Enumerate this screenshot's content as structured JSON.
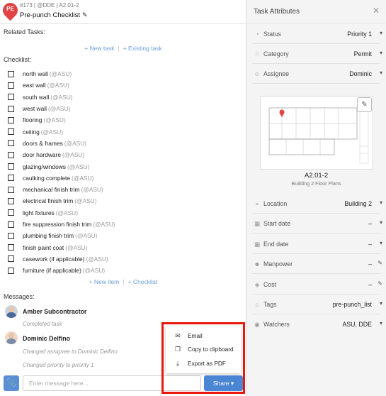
{
  "header": {
    "avatar_initials": "PE",
    "meta": "#173 | @DDE | A2.01-2",
    "title": "Pre-punch Checklist"
  },
  "related_tasks": {
    "label": "Related Tasks:",
    "new_task": "+ New task",
    "existing_task": "+ Existing task",
    "separator": "|"
  },
  "checklist": {
    "label": "Checklist:",
    "items": [
      {
        "name": "north wall",
        "assignee": "(@ASU)"
      },
      {
        "name": "east wall",
        "assignee": "(@ASU)"
      },
      {
        "name": "south wall",
        "assignee": "(@ASU)"
      },
      {
        "name": "west wall",
        "assignee": "(@ASU)"
      },
      {
        "name": "flooring",
        "assignee": "(@ASU)"
      },
      {
        "name": "ceiling",
        "assignee": "(@ASU)"
      },
      {
        "name": "doors & frames",
        "assignee": "(@ASU)"
      },
      {
        "name": "door hardware",
        "assignee": "(@ASU)"
      },
      {
        "name": "glazing/windows",
        "assignee": "(@ASU)"
      },
      {
        "name": "caulking complete",
        "assignee": "(@ASU)"
      },
      {
        "name": "mechanical finish trim",
        "assignee": "(@ASU)"
      },
      {
        "name": "electrical finish trim",
        "assignee": "(@ASU)"
      },
      {
        "name": "light fixtures",
        "assignee": "(@ASU)"
      },
      {
        "name": "fire suppression finish trim",
        "assignee": "(@ASU)"
      },
      {
        "name": "plumbing finish trim",
        "assignee": "(@ASU)"
      },
      {
        "name": "finish paint coat",
        "assignee": "(@ASU)"
      },
      {
        "name": "casework (if applicable)",
        "assignee": "(@ASU)"
      },
      {
        "name": "furniture (if applicable)",
        "assignee": "(@ASU)"
      }
    ],
    "new_item": "+ New item",
    "add_checklist": "+ Checklist",
    "separator": "|"
  },
  "messages": {
    "label": "Messages:",
    "entries": [
      {
        "author": "Amber Subcontractor",
        "notes": [
          "Completed task"
        ]
      },
      {
        "author": "Dominic Delfino",
        "notes": [
          "Changed assignee to Dominic Delfino",
          "Changed priority to priority 1"
        ]
      }
    ],
    "input_placeholder": "Enter message here...",
    "share_label": "Share ▾"
  },
  "share_menu": {
    "items": [
      {
        "label": "Email",
        "icon": "envelope-icon"
      },
      {
        "label": "Copy to clipboard",
        "icon": "copy-icon"
      },
      {
        "label": "Export as PDF",
        "icon": "download-icon"
      }
    ]
  },
  "attributes": {
    "title": "Task Attributes",
    "rows": [
      {
        "label": "Status",
        "value": "Priority 1",
        "icon": "status-icon"
      },
      {
        "label": "Category",
        "value": "Permit",
        "icon": "grid-icon"
      },
      {
        "label": "Assignee",
        "value": "Dominic",
        "icon": "person-icon"
      }
    ],
    "sheet": {
      "name": "A2.01-2",
      "subtitle": "Building 2 Floor Plans"
    },
    "rows2": [
      {
        "label": "Location",
        "value": "Building 2",
        "icon": "location-pin-icon",
        "control": "▾"
      },
      {
        "label": "Start date",
        "value": "–",
        "icon": "calendar-icon",
        "control": "▾"
      },
      {
        "label": "End date",
        "value": "–",
        "icon": "calendar-icon",
        "control": "▾"
      },
      {
        "label": "Manpower",
        "value": "–",
        "icon": "people-icon",
        "control": "✎"
      },
      {
        "label": "Cost",
        "value": "–",
        "icon": "cost-icon",
        "control": "✎"
      },
      {
        "label": "Tags",
        "value": "pre-punch_list",
        "icon": "tag-icon",
        "control": "▾"
      },
      {
        "label": "Watchers",
        "value": "ASU, DDE",
        "icon": "eye-icon",
        "control": "▾"
      }
    ]
  },
  "colors": {
    "accent": "#4a86d4",
    "link": "#6a9fd8",
    "pin": "#e04444",
    "highlight": "#e8180e"
  }
}
